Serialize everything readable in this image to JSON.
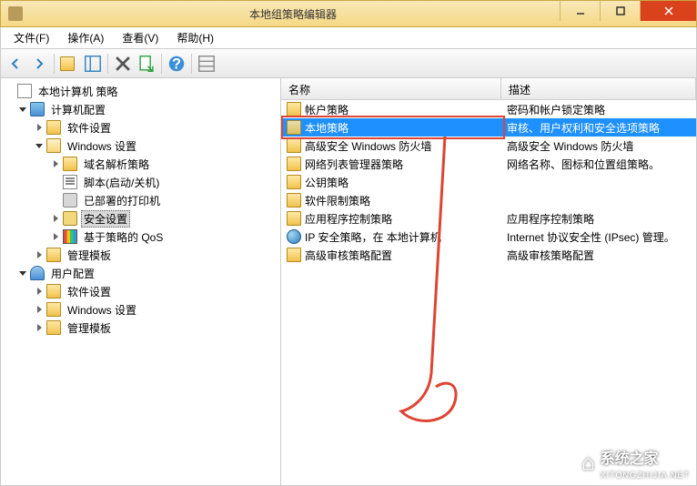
{
  "window": {
    "title": "本地组策略编辑器"
  },
  "menu": {
    "file": "文件(F)",
    "action": "操作(A)",
    "view": "查看(V)",
    "help": "帮助(H)"
  },
  "tree": {
    "root": "本地计算机 策略",
    "computer_cfg": "计算机配置",
    "software_settings": "软件设置",
    "windows_settings": "Windows 设置",
    "dns_policy": "域名解析策略",
    "scripts": "脚本(启动/关机)",
    "deployed_printers": "已部署的打印机",
    "security_settings": "安全设置",
    "qos": "基于策略的 QoS",
    "admin_templates": "管理模板",
    "user_cfg": "用户配置",
    "software_settings2": "软件设置",
    "windows_settings2": "Windows 设置",
    "admin_templates2": "管理模板"
  },
  "list": {
    "header_name": "名称",
    "header_desc": "描述",
    "rows": {
      "r0": {
        "name": "帐户策略",
        "desc": "密码和帐户锁定策略"
      },
      "r1": {
        "name": "本地策略",
        "desc": "审核、用户权利和安全选项策略"
      },
      "r2": {
        "name": "高级安全 Windows 防火墙",
        "desc": "高级安全 Windows 防火墙"
      },
      "r3": {
        "name": "网络列表管理器策略",
        "desc": "网络名称、图标和位置组策略。"
      },
      "r4": {
        "name": "公钥策略",
        "desc": ""
      },
      "r5": {
        "name": "软件限制策略",
        "desc": ""
      },
      "r6": {
        "name": "应用程序控制策略",
        "desc": "应用程序控制策略"
      },
      "r7": {
        "name": "IP 安全策略，在 本地计算机",
        "desc": "Internet 协议安全性 (IPsec) 管理。"
      },
      "r8": {
        "name": "高级审核策略配置",
        "desc": "高级审核策略配置"
      }
    }
  },
  "watermark": {
    "brand": "系统之家",
    "url": "XITONGZHIJIA.NET"
  }
}
